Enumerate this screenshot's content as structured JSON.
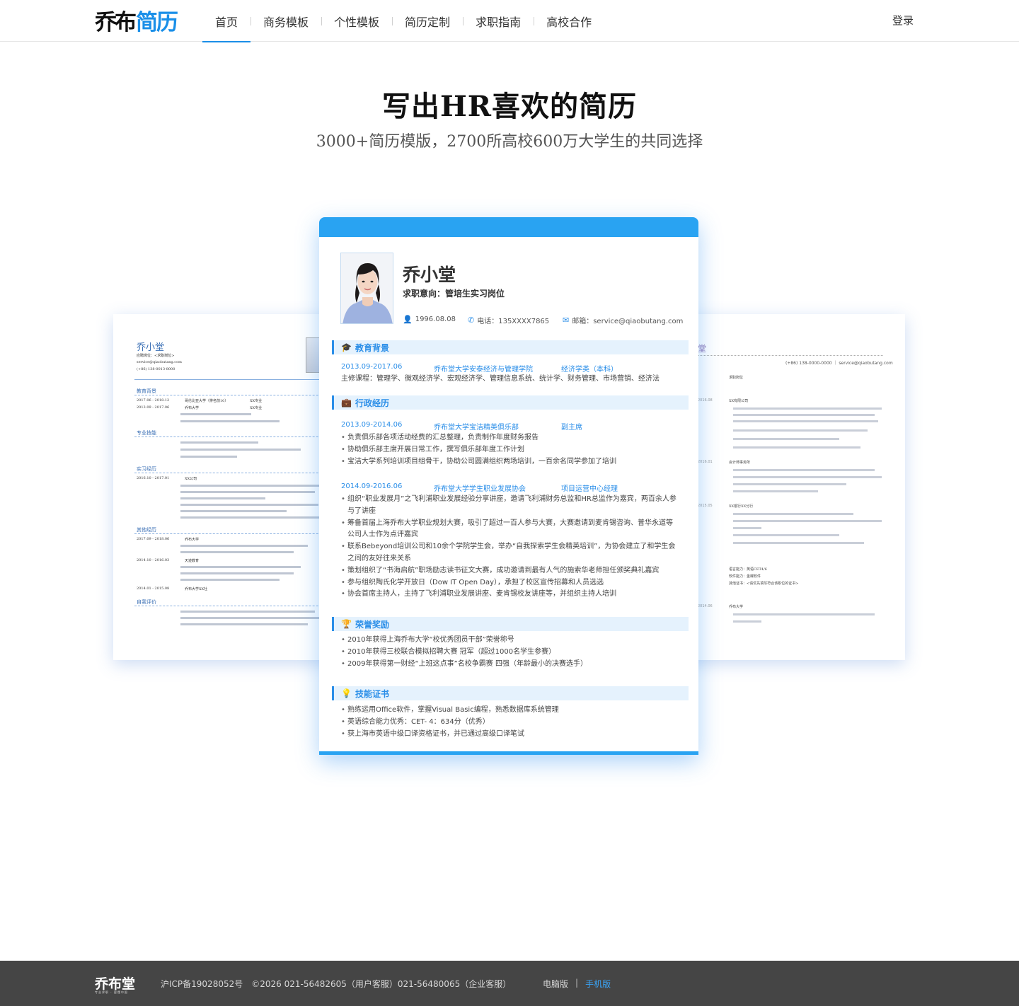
{
  "header": {
    "logo_black": "乔布",
    "logo_blue": "简历",
    "nav": [
      "首页",
      "商务模板",
      "个性模板",
      "简历定制",
      "求职指南",
      "高校合作"
    ],
    "login": "登录"
  },
  "hero": {
    "title": "写出HR喜欢的简历",
    "subtitle": "3000+简历模版，2700所高校600万大学生的共同选择"
  },
  "left_resume": {
    "name": "乔小堂",
    "lines": [
      "应聘岗位：<求职岗位>",
      "service@qiaobutang.com",
      "(+86) 138-0013-8000"
    ],
    "sections": [
      "教育背景",
      "专业技能",
      "实习经历",
      "其他经历",
      "自我评价"
    ],
    "rows": [
      {
        "d": "2017.06 - 2018.12",
        "t": "哥伦比亚大学（排名前10）",
        "m": "XX专业"
      },
      {
        "d": "2013.09 - 2017.06",
        "t": "乔布大学",
        "m": "XX专业"
      },
      {
        "d": "2016.10 - 2017.01",
        "t": "XX公司",
        "m": ""
      },
      {
        "d": "2017.09 - 2018.06",
        "t": "乔布大学",
        "m": ""
      },
      {
        "d": "2014.10 - 2016.03",
        "t": "天迹教育",
        "m": ""
      },
      {
        "d": "2014.01 - 2015.08",
        "t": "乔布大学XX社",
        "m": ""
      }
    ]
  },
  "right_resume": {
    "name": "堂",
    "contact": "(+86) 138-0000-0000 ｜ service@qiaobutang.com",
    "label": "求职岗位",
    "dates": [
      "2016.08",
      "2016.01",
      "2015.05",
      "2014.06"
    ],
    "orgs": [
      "XX有限公司",
      "会计师事务所",
      "XX银行XX分行",
      "乔布大学"
    ],
    "extra": [
      "语言能力：英语CET4/6",
      "软件能力：金蝶软件",
      "其他证书：<请优先填写符合该职位的证书>"
    ]
  },
  "main_resume": {
    "name": "乔小堂",
    "intent": "求职意向：管培生实习岗位",
    "birth": "1996.08.08",
    "phone": "电话：135XXXX7865",
    "email": "邮箱：service@qiaobutang.com",
    "education": {
      "title": "教育背景",
      "date": "2013.09-2017.06",
      "school": "乔布堂大学安泰经济与管理学院",
      "major": "经济学类（本科）",
      "courses": "主修课程：管理学、微观经济学、宏观经济学、管理信息系统、统计学、财务管理、市场营销、经济法"
    },
    "admin": {
      "title": "行政经历",
      "exp1": {
        "date": "2013.09-2014.06",
        "org": "乔布堂大学宝洁精英俱乐部",
        "role": "副主席",
        "bullets": [
          "负责俱乐部各项活动经费的汇总整理，负责制作年度财务报告",
          "协助俱乐部主席开展日常工作，撰写俱乐部年度工作计划",
          "宝洁大学系列培训项目组骨干，协助公司圆满组织两场培训，一百余名同学参加了培训"
        ]
      },
      "exp2": {
        "date": "2014.09-2016.06",
        "org": "乔布堂大学学生职业发展协会",
        "role": "项目运营中心经理",
        "bullets": [
          "组织“职业发展月”之飞利浦职业发展经验分享讲座，邀请飞利浦财务总监和HR总监作为嘉宾，两百余人参与了讲座",
          "筹备首届上海乔布大学职业规划大赛，吸引了超过一百人参与大赛，大赛邀请到麦肯锡咨询、普华永道等公司人士作为点评嘉宾",
          "联系Bebeyond培训公司和10余个学院学生会，举办“自我探索学生会精英培训”，为协会建立了和学生会之间的友好往来关系",
          "策划组织了“书海启航”职场励志读书征文大赛，成功邀请到最有人气的施索华老师担任颁奖典礼嘉宾",
          "参与组织陶氏化学开放日（Dow IT Open Day），承担了校区宣传招募和人员选选",
          "协会首席主持人，主持了飞利浦职业发展讲座、麦肯锡校友讲座等，并组织主持人培训"
        ]
      }
    },
    "honors": {
      "title": "荣誉奖励",
      "bullets": [
        "2010年获得上海乔布大学“校优秀团员干部”荣誉称号",
        "2010年获得三校联合模拟招聘大赛 冠军（超过1000名学生参赛）",
        "2009年获得第一财经“上班这点事”名校争霸赛 四强（年龄最小的决赛选手）"
      ]
    },
    "skills": {
      "title": "技能证书",
      "bullets": [
        "熟练运用Office软件，掌握Visual Basic编程，熟悉数据库系统管理",
        "英语综合能力优秀：CET- 4：634分（优秀）",
        "获上海市英语中级口译资格证书，并已通过高级口译笔试"
      ]
    }
  },
  "footer": {
    "logo": "乔布堂",
    "logo_sub": "专业求职 · 更懂中国",
    "icp": "沪ICP备19028052号　©2026 021-56482605（用户客服）021-56480065（企业客服）",
    "pc": "电脑版",
    "sep": "|",
    "mobile": "手机版"
  },
  "colors": {
    "accent": "#1a8fe8",
    "resume_blue": "#29a3f2",
    "footer_bg": "#454545"
  }
}
